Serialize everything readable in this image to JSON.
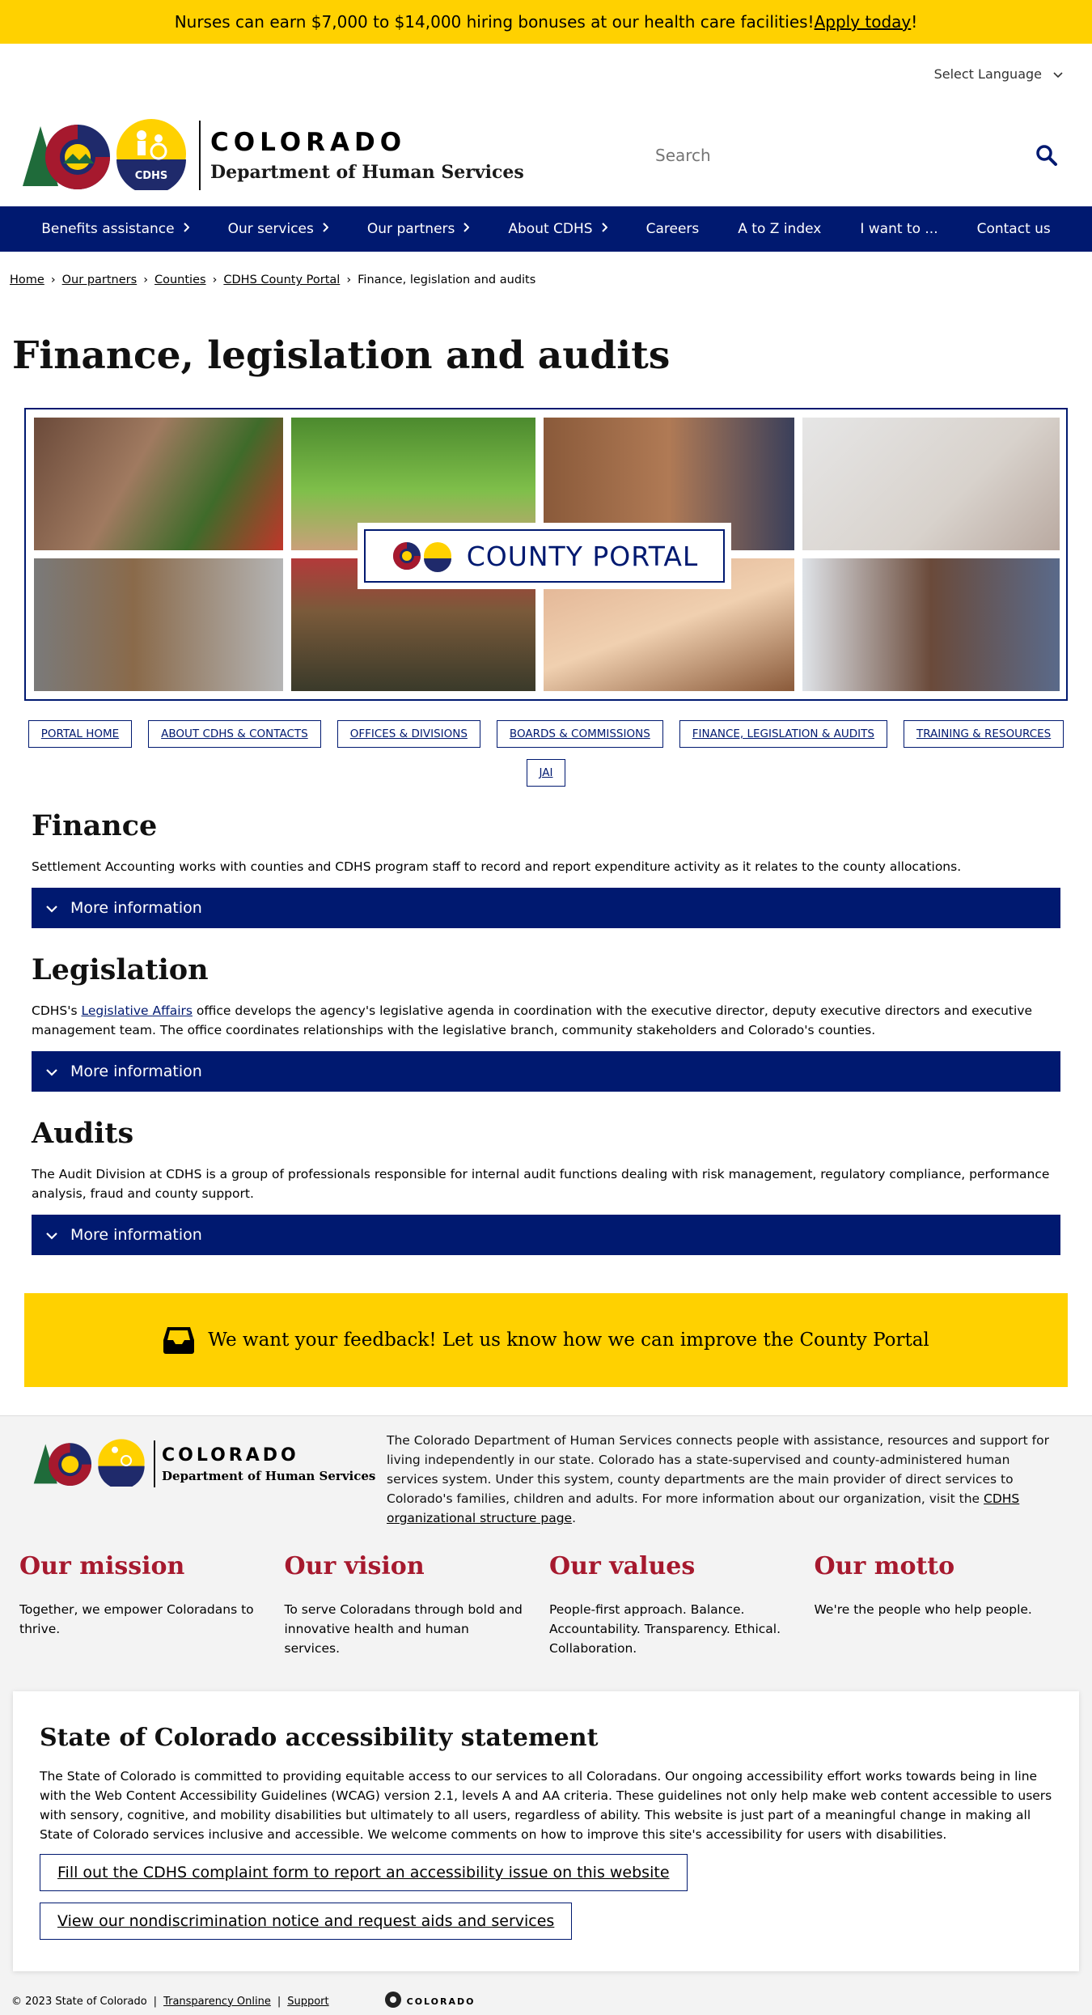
{
  "alert": {
    "text": "Nurses can earn $7,000 to $14,000 hiring bonuses at our health care facilities! ",
    "link": "Apply today",
    "end": "!"
  },
  "language": {
    "label": "Select Language"
  },
  "brand": {
    "line1": "COLORADO",
    "line2": "Department of Human Services",
    "badge": "CDHS"
  },
  "search": {
    "placeholder": "Search"
  },
  "nav": [
    {
      "label": "Benefits assistance",
      "has_chevron": true
    },
    {
      "label": "Our services",
      "has_chevron": true
    },
    {
      "label": "Our partners",
      "has_chevron": true
    },
    {
      "label": "About CDHS",
      "has_chevron": true
    },
    {
      "label": "Careers",
      "has_chevron": false
    },
    {
      "label": "A to Z index",
      "has_chevron": false
    },
    {
      "label": "I want to ...",
      "has_chevron": false
    },
    {
      "label": "Contact us",
      "has_chevron": false
    }
  ],
  "breadcrumb": {
    "home": "Home",
    "partners": "Our partners",
    "counties": "Counties",
    "portal": "CDHS County Portal",
    "current": "Finance, legislation and audits"
  },
  "page": {
    "title": "Finance, legislation and audits"
  },
  "hero": {
    "portal_label": "COUNTY PORTAL"
  },
  "tabs": [
    "PORTAL HOME",
    "ABOUT CDHS & CONTACTS",
    "OFFICES & DIVISIONS",
    "BOARDS & COMMISSIONS",
    "FINANCE, LEGISLATION & AUDITS",
    "TRAINING & RESOURCES",
    "JAI"
  ],
  "finance": {
    "heading": "Finance",
    "body": "Settlement Accounting works with counties and CDHS program staff to record and report expenditure activity as it relates to the county allocations.",
    "more": "More information"
  },
  "legislation": {
    "heading": "Legislation",
    "body_pre": "CDHS's ",
    "body_link": "Legislative Affairs",
    "body_post": " office develops the agency's legislative agenda in coordination with the executive director, deputy executive directors and executive management team. The office coordinates relationships with the legislative branch, community stakeholders and Colorado's counties.",
    "more": "More information"
  },
  "audits": {
    "heading": "Audits",
    "body": "The Audit Division at CDHS is a group of professionals responsible for internal audit functions dealing with risk management, regulatory compliance, performance analysis, fraud and county support.",
    "more": "More information"
  },
  "feedback": {
    "text": "We want your feedback! Let us know how we can improve the County Portal"
  },
  "footer": {
    "about_pre": "The Colorado Department of Human Services connects people with assistance, resources and support for living independently in our state. Colorado has a state-supervised and county-administered human services system. Under this system, county departments are the main provider of direct services to Colorado's families, children and adults. For more information about our organization, visit the ",
    "about_link": "CDHS organizational structure page",
    "about_post": ".",
    "columns": [
      {
        "title": "Our mission",
        "text": "Together, we empower Coloradans to thrive."
      },
      {
        "title": "Our vision",
        "text": "To serve Coloradans through bold and innovative health and human services."
      },
      {
        "title": "Our values",
        "text": "People-first approach. Balance. Accountability. Transparency. Ethical. Collaboration."
      },
      {
        "title": "Our motto",
        "text": "We're the people who help people."
      }
    ],
    "a11y": {
      "heading": "State of Colorado accessibility statement",
      "body": "The State of Colorado is committed to providing equitable access to our services to all Coloradans. Our ongoing accessibility effort works towards being in line with the Web Content Accessibility Guidelines (WCAG) version 2.1, levels A and AA criteria. These guidelines not only help make web content accessible to users with sensory, cognitive, and mobility disabilities but ultimately to all users, regardless of ability. This website is just part of a meaningful change in making all State of Colorado services inclusive and accessible. We welcome comments on how to improve this site's accessibility for users with disabilities.",
      "btn1": "Fill out the CDHS complaint form to report an accessibility issue on this website",
      "btn2": "View our nondiscrimination notice and request aids and services"
    },
    "copyright": "© 2023 State of Colorado",
    "transparency": "Transparency Online",
    "support": "Support",
    "small_brand": "COLORADO"
  },
  "colors": {
    "navy": "#001970",
    "yellow": "#FFD100",
    "crimson": "#A6192E"
  }
}
